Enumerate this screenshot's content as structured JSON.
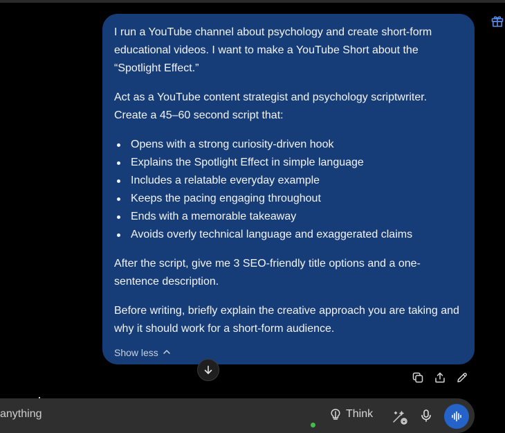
{
  "message": {
    "intro": "I run a YouTube channel about psychology and create short-form educational videos. I want to make a YouTube Short about the “Spotlight Effect.”",
    "role": "Act as a YouTube content strategist and psychology scriptwriter. Create a 45–60 second script that:",
    "bullets": [
      "Opens with a strong curiosity-driven hook",
      "Explains the Spotlight Effect in simple language",
      "Includes a relatable everyday example",
      "Keeps the pacing engaging throughout",
      "Ends with a memorable takeaway",
      "Avoids overly technical language and exaggerated claims"
    ],
    "after": "After the script, give me 3 SEO-friendly title options and a one-sentence description.",
    "before": "Before writing, briefly explain the creative approach you are taking and why it should work for a short-form audience.",
    "show_less_label": "Show less"
  },
  "composer": {
    "input_value": "anything",
    "think_label": "Think"
  },
  "icons": {
    "gift": "gift-icon",
    "chevron": "chevron-up-icon",
    "scroll": "arrow-down-icon",
    "copy": "copy-icon",
    "share": "share-icon",
    "edit": "edit-icon",
    "think": "lightbulb-icon",
    "tools": "tools-icon",
    "mic": "microphone-icon",
    "voice": "voice-waveform-icon"
  },
  "colors": {
    "bubble": "#173d78",
    "accent": "#2563c9",
    "status": "#3fbf4a"
  }
}
